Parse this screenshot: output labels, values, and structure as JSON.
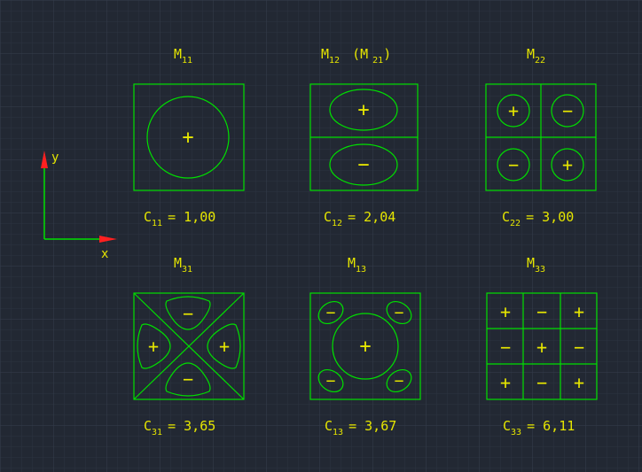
{
  "background_color": "#222833",
  "geometry_color": "#00e000",
  "text_color": "#e6e600",
  "axis": {
    "x_label": "x",
    "y_label": "y",
    "x_color": "#00e000",
    "y_color": "#00e000",
    "arrow_color": "#ff2020"
  },
  "modes": [
    {
      "label_main": "M",
      "label_sub": "11",
      "label_extra_main": "",
      "label_extra_sub": "",
      "label_extra_close": "",
      "coef_main": "C",
      "coef_sub": "11",
      "coef_value": "= 1,00"
    },
    {
      "label_main": "M",
      "label_sub": "12",
      "label_extra_main": "(M",
      "label_extra_sub": "21",
      "label_extra_close": ")",
      "coef_main": "C",
      "coef_sub": "12",
      "coef_value": "= 2,04"
    },
    {
      "label_main": "M",
      "label_sub": "22",
      "label_extra_main": "",
      "label_extra_sub": "",
      "label_extra_close": "",
      "coef_main": "C",
      "coef_sub": "22",
      "coef_value": "= 3,00"
    },
    {
      "label_main": "M",
      "label_sub": "31",
      "label_extra_main": "",
      "label_extra_sub": "",
      "label_extra_close": "",
      "coef_main": "C",
      "coef_sub": "31",
      "coef_value": "= 3,65"
    },
    {
      "label_main": "M",
      "label_sub": "13",
      "label_extra_main": "",
      "label_extra_sub": "",
      "label_extra_close": "",
      "coef_main": "C",
      "coef_sub": "13",
      "coef_value": "= 3,67"
    },
    {
      "label_main": "M",
      "label_sub": "33",
      "label_extra_main": "",
      "label_extra_sub": "",
      "label_extra_close": "",
      "coef_main": "C",
      "coef_sub": "33",
      "coef_value": "= 6,11"
    }
  ],
  "m22_signs": [
    "+",
    "−",
    "−",
    "+"
  ],
  "m12_signs": [
    "+",
    "−"
  ],
  "m11_signs": [
    "+"
  ],
  "m31_signs": [
    "−",
    "+",
    "+",
    "−"
  ],
  "m13_signs": [
    "−",
    "−",
    "+",
    "−",
    "−"
  ],
  "m33_signs": [
    "+",
    "−",
    "+",
    "−",
    "+",
    "−",
    "+",
    "−",
    "+"
  ]
}
